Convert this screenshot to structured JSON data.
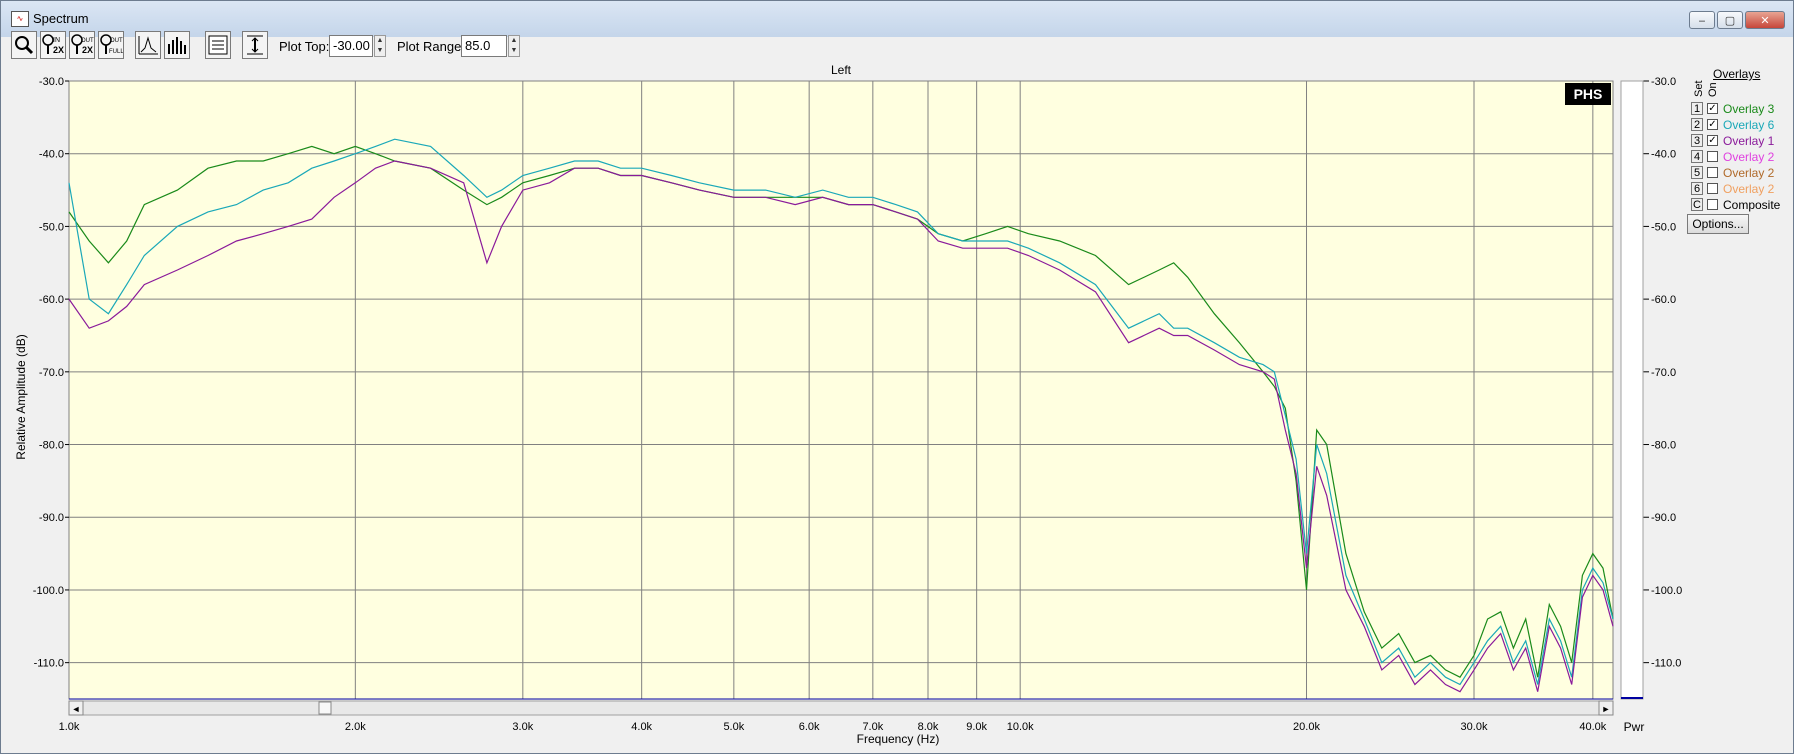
{
  "window": {
    "title": "Spectrum",
    "minimize_glyph": "‒",
    "maximize_glyph": "▢",
    "close_glyph": "✕"
  },
  "toolbar": {
    "tools": [
      {
        "name": "zoom-tool",
        "icon": "magnifier-icon",
        "glyph": "🔍"
      },
      {
        "name": "zoom-in-2x",
        "icon": "zoom-in-2x-icon",
        "glyph": "IN 2X"
      },
      {
        "name": "zoom-out-2x",
        "icon": "zoom-out-2x-icon",
        "glyph": "OUT 2X"
      },
      {
        "name": "zoom-out-full",
        "icon": "zoom-out-full-icon",
        "glyph": "OUT FULL"
      },
      {
        "name": "line-plot",
        "icon": "line-plot-icon",
        "glyph": "⅄"
      },
      {
        "name": "bar-plot",
        "icon": "bar-plot-icon",
        "glyph": "▥"
      },
      {
        "name": "settings-panel",
        "icon": "settings-panel-icon",
        "glyph": "☰"
      },
      {
        "name": "auto-scale",
        "icon": "auto-scale-icon",
        "glyph": "↕"
      }
    ],
    "plot_top_label": "Plot Top:",
    "plot_top_value": "-30.00",
    "plot_range_label": "Plot Range:",
    "plot_range_value": "85.0"
  },
  "overlays": {
    "title": "Overlays",
    "set_header": "Set",
    "on_header": "On",
    "items": [
      {
        "set": "1",
        "checked": true,
        "label": "Overlay 3",
        "color": "#1a8a1a"
      },
      {
        "set": "2",
        "checked": true,
        "label": "Overlay 6",
        "color": "#1aa8b8"
      },
      {
        "set": "3",
        "checked": true,
        "label": "Overlay 1",
        "color": "#8a1a9a"
      },
      {
        "set": "4",
        "checked": false,
        "label": "Overlay 2",
        "color": "#e040e0"
      },
      {
        "set": "5",
        "checked": false,
        "label": "Overlay 2",
        "color": "#b06a2a"
      },
      {
        "set": "6",
        "checked": false,
        "label": "Overlay 2",
        "color": "#f0a060"
      },
      {
        "set": "C",
        "checked": false,
        "label": "Composite",
        "color": "#000000"
      }
    ],
    "options_label": "Options..."
  },
  "chart_data": {
    "type": "line",
    "title": "Left",
    "xlabel": "Frequency (Hz)",
    "ylabel": "Relative Amplitude (dB)",
    "xscale": "log",
    "xlim": [
      1000,
      42000
    ],
    "ylim": [
      -115,
      -30
    ],
    "x_ticks": [
      "1.0k",
      "2.0k",
      "3.0k",
      "4.0k",
      "5.0k",
      "6.0k",
      "7.0k",
      "8.0k",
      "9.0k",
      "10.0k",
      "20.0k",
      "30.0k",
      "40.0k"
    ],
    "x_tick_values": [
      1000,
      2000,
      3000,
      4000,
      5000,
      6000,
      7000,
      8000,
      9000,
      10000,
      20000,
      30000,
      40000
    ],
    "y_ticks": [
      "-30.0",
      "-40.0",
      "-50.0",
      "-60.0",
      "-70.0",
      "-80.0",
      "-90.0",
      "-100.0",
      "-110.0"
    ],
    "y_tick_values": [
      -30,
      -40,
      -50,
      -60,
      -70,
      -80,
      -90,
      -100,
      -110
    ],
    "grid": true,
    "badge": "PHS",
    "right_axis_footer": "Pwr",
    "background": "#ffffe0",
    "series": [
      {
        "name": "Overlay 3",
        "color": "#1a8a1a",
        "x": [
          1000,
          1050,
          1100,
          1150,
          1200,
          1300,
          1400,
          1500,
          1600,
          1700,
          1800,
          1900,
          2000,
          2100,
          2200,
          2400,
          2600,
          2750,
          2850,
          3000,
          3200,
          3400,
          3600,
          3800,
          4000,
          4300,
          4600,
          5000,
          5400,
          5800,
          6200,
          6600,
          7000,
          7400,
          7800,
          8200,
          8700,
          9200,
          9700,
          10200,
          11000,
          12000,
          13000,
          14000,
          14500,
          15000,
          16000,
          17000,
          18000,
          18500,
          19000,
          19500,
          20000,
          20500,
          21000,
          22000,
          23000,
          24000,
          25000,
          26000,
          27000,
          28000,
          29000,
          30000,
          31000,
          32000,
          33000,
          34000,
          35000,
          36000,
          37000,
          38000,
          39000,
          40000,
          41000,
          42000
        ],
        "y": [
          -48,
          -52,
          -55,
          -52,
          -47,
          -45,
          -42,
          -41,
          -41,
          -40,
          -39,
          -40,
          -39,
          -40,
          -41,
          -42,
          -45,
          -47,
          -46,
          -44,
          -43,
          -42,
          -42,
          -43,
          -43,
          -44,
          -45,
          -46,
          -46,
          -46,
          -46,
          -47,
          -47,
          -48,
          -49,
          -51,
          -52,
          -51,
          -50,
          -51,
          -52,
          -54,
          -58,
          -56,
          -55,
          -57,
          -62,
          -66,
          -70,
          -72,
          -75,
          -85,
          -100,
          -78,
          -80,
          -95,
          -103,
          -108,
          -106,
          -110,
          -109,
          -111,
          -112,
          -109,
          -104,
          -103,
          -108,
          -104,
          -112,
          -102,
          -105,
          -110,
          -98,
          -95,
          -97,
          -104
        ]
      },
      {
        "name": "Overlay 6",
        "color": "#1aa8b8",
        "x": [
          1000,
          1050,
          1100,
          1150,
          1200,
          1300,
          1400,
          1500,
          1600,
          1700,
          1800,
          1900,
          2000,
          2100,
          2200,
          2400,
          2600,
          2750,
          2850,
          3000,
          3200,
          3400,
          3600,
          3800,
          4000,
          4300,
          4600,
          5000,
          5400,
          5800,
          6200,
          6600,
          7000,
          7400,
          7800,
          8200,
          8700,
          9200,
          9700,
          10200,
          11000,
          12000,
          13000,
          14000,
          14500,
          15000,
          16000,
          17000,
          18000,
          18500,
          19000,
          19500,
          20000,
          20500,
          21000,
          22000,
          23000,
          24000,
          25000,
          26000,
          27000,
          28000,
          29000,
          30000,
          31000,
          32000,
          33000,
          34000,
          35000,
          36000,
          37000,
          38000,
          39000,
          40000,
          41000,
          42000
        ],
        "y": [
          -44,
          -60,
          -62,
          -58,
          -54,
          -50,
          -48,
          -47,
          -45,
          -44,
          -42,
          -41,
          -40,
          -39,
          -38,
          -39,
          -43,
          -46,
          -45,
          -43,
          -42,
          -41,
          -41,
          -42,
          -42,
          -43,
          -44,
          -45,
          -45,
          -46,
          -45,
          -46,
          -46,
          -47,
          -48,
          -51,
          -52,
          -52,
          -52,
          -53,
          -55,
          -58,
          -64,
          -62,
          -64,
          -64,
          -66,
          -68,
          -69,
          -70,
          -76,
          -82,
          -95,
          -80,
          -84,
          -98,
          -104,
          -110,
          -108,
          -112,
          -110,
          -112,
          -113,
          -110,
          -107,
          -105,
          -110,
          -107,
          -113,
          -104,
          -107,
          -112,
          -100,
          -97,
          -99,
          -104
        ]
      },
      {
        "name": "Overlay 1",
        "color": "#8a1a9a",
        "x": [
          1000,
          1050,
          1100,
          1150,
          1200,
          1300,
          1400,
          1500,
          1600,
          1700,
          1800,
          1900,
          2000,
          2100,
          2200,
          2400,
          2600,
          2750,
          2850,
          3000,
          3200,
          3400,
          3600,
          3800,
          4000,
          4300,
          4600,
          5000,
          5400,
          5800,
          6200,
          6600,
          7000,
          7400,
          7800,
          8200,
          8700,
          9200,
          9700,
          10200,
          11000,
          12000,
          13000,
          14000,
          14500,
          15000,
          16000,
          17000,
          18000,
          18500,
          19000,
          19500,
          20000,
          20500,
          21000,
          22000,
          23000,
          24000,
          25000,
          26000,
          27000,
          28000,
          29000,
          30000,
          31000,
          32000,
          33000,
          34000,
          35000,
          36000,
          37000,
          38000,
          39000,
          40000,
          41000,
          42000
        ],
        "y": [
          -60,
          -64,
          -63,
          -61,
          -58,
          -56,
          -54,
          -52,
          -51,
          -50,
          -49,
          -46,
          -44,
          -42,
          -41,
          -42,
          -44,
          -55,
          -50,
          -45,
          -44,
          -42,
          -42,
          -43,
          -43,
          -44,
          -45,
          -46,
          -46,
          -47,
          -46,
          -47,
          -47,
          -48,
          -49,
          -52,
          -53,
          -53,
          -53,
          -54,
          -56,
          -59,
          -66,
          -64,
          -65,
          -65,
          -67,
          -69,
          -70,
          -71,
          -78,
          -84,
          -97,
          -83,
          -87,
          -100,
          -105,
          -111,
          -109,
          -113,
          -111,
          -113,
          -114,
          -111,
          -108,
          -106,
          -111,
          -108,
          -114,
          -105,
          -108,
          -113,
          -101,
          -98,
          -100,
          -105
        ]
      }
    ]
  }
}
